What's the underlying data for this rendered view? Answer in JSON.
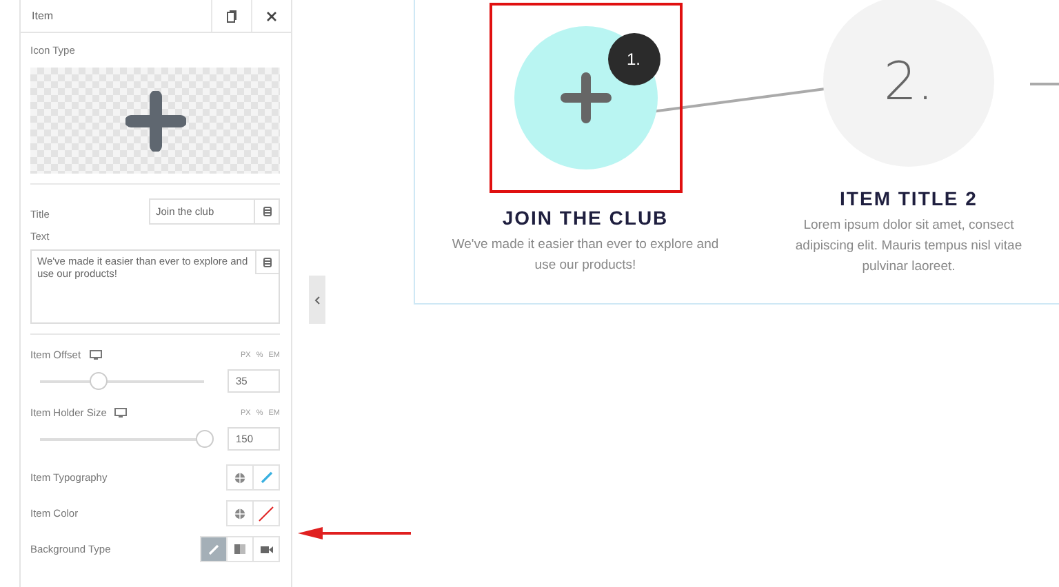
{
  "panel": {
    "title": "Item",
    "icon_type": {
      "label": "Icon Type"
    },
    "title_field": {
      "label": "Title",
      "value": "Join the club"
    },
    "text_field": {
      "label": "Text",
      "value": "We've made it easier than ever to explore and use our products!"
    },
    "controls": [
      {
        "kind": "slider",
        "label": "Item Offset",
        "units": [
          "PX",
          "%",
          "EM"
        ],
        "level": 0.35,
        "value": "35"
      },
      {
        "kind": "slider",
        "label": "Item Holder Size",
        "units": [
          "PX",
          "%",
          "EM"
        ],
        "level": 1,
        "value": "150"
      },
      {
        "kind": "typography",
        "label": "Item Typography"
      },
      {
        "kind": "color",
        "label": "Item Color"
      },
      {
        "kind": "background",
        "label": "Background Type",
        "options": [
          {
            "kind": "classic",
            "selected": true
          },
          {
            "kind": "gradient",
            "selected": false
          },
          {
            "kind": "video",
            "selected": false
          }
        ]
      }
    ]
  },
  "canvas": {
    "steps": [
      {
        "badge": "1.",
        "highlighted": true,
        "filled": true,
        "title": "JOIN THE CLUB",
        "text": [
          "We've made it easier than ever to explore and",
          "use our products!"
        ]
      },
      {
        "number": "2.",
        "highlighted": false,
        "filled": false,
        "title": "ITEM TITLE 2",
        "text": [
          "Lorem ipsum dolor sit amet, consect",
          "adipiscing elit. Mauris tempus nisl vitae",
          "pulvinar laoreet."
        ]
      }
    ]
  }
}
